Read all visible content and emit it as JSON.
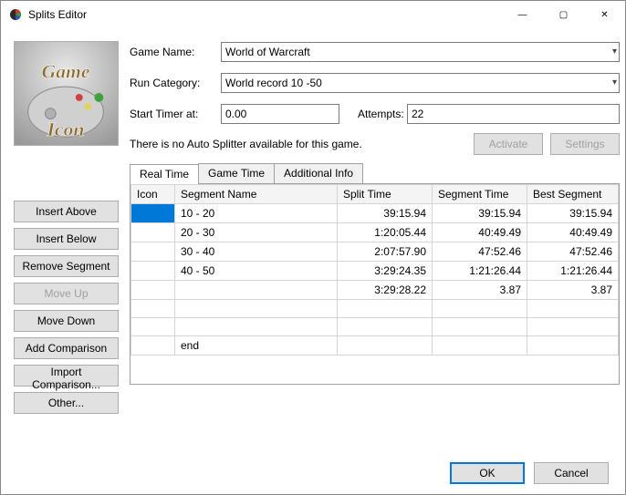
{
  "window": {
    "title": "Splits Editor",
    "min": "—",
    "max": "▢",
    "close": "✕"
  },
  "gameIconText1": "Game",
  "gameIconText2": "Icon",
  "sidebar": {
    "insert_above": "Insert Above",
    "insert_below": "Insert Below",
    "remove_segment": "Remove Segment",
    "move_up": "Move Up",
    "move_down": "Move Down",
    "add_comparison": "Add Comparison",
    "import_comparison": "Import Comparison...",
    "other": "Other..."
  },
  "form": {
    "game_name_label": "Game Name:",
    "game_name_value": "World of Warcraft",
    "run_category_label": "Run Category:",
    "run_category_value": "World record 10 -50",
    "start_timer_label": "Start Timer at:",
    "start_timer_value": "0.00",
    "attempts_label": "Attempts:",
    "attempts_value": "22",
    "autosplitter_msg": "There is no Auto Splitter available for this game.",
    "activate": "Activate",
    "settings": "Settings"
  },
  "tabs": {
    "real_time": "Real Time",
    "game_time": "Game Time",
    "additional_info": "Additional Info"
  },
  "grid": {
    "headers": {
      "icon": "Icon",
      "segment_name": "Segment Name",
      "split_time": "Split Time",
      "segment_time": "Segment Time",
      "best_segment": "Best Segment"
    },
    "rows": [
      {
        "name": "10 - 20",
        "split": "39:15.94",
        "seg": "39:15.94",
        "best": "39:15.94"
      },
      {
        "name": "20 - 30",
        "split": "1:20:05.44",
        "seg": "40:49.49",
        "best": "40:49.49"
      },
      {
        "name": "30 - 40",
        "split": "2:07:57.90",
        "seg": "47:52.46",
        "best": "47:52.46"
      },
      {
        "name": "40 - 50",
        "split": "3:29:24.35",
        "seg": "1:21:26.44",
        "best": "1:21:26.44"
      },
      {
        "name": "",
        "split": "3:29:28.22",
        "seg": "3.87",
        "best": "3.87"
      },
      {
        "name": "",
        "split": "",
        "seg": "",
        "best": ""
      },
      {
        "name": "",
        "split": "",
        "seg": "",
        "best": ""
      },
      {
        "name": "end",
        "split": "",
        "seg": "",
        "best": ""
      }
    ]
  },
  "footer": {
    "ok": "OK",
    "cancel": "Cancel"
  }
}
